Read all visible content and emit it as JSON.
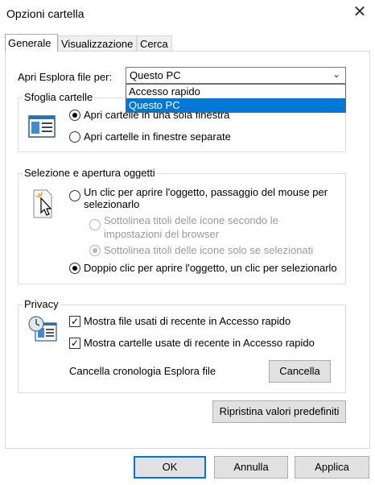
{
  "window": {
    "title": "Opzioni cartella",
    "close_glyph": "✕"
  },
  "tabs": [
    {
      "label": "Generale",
      "active": true
    },
    {
      "label": "Visualizzazione",
      "active": false
    },
    {
      "label": "Cerca",
      "active": false
    }
  ],
  "open_explorer": {
    "label": "Apri Esplora file per:",
    "selected": "Questo PC",
    "options": [
      "Accesso rapido",
      "Questo PC"
    ],
    "highlighted_option": "Questo PC"
  },
  "browse_folders": {
    "legend": "Sfoglia cartelle",
    "option_same_window": "Apri cartelle in una sola finestra",
    "option_separate_windows": "Apri cartelle in finestre separate",
    "selected": "same_window"
  },
  "click_items": {
    "legend": "Selezione e apertura oggetti",
    "single_click_line1": "Un clic per aprire l'oggetto, passaggio del mouse per",
    "single_click_line2": "selezionarlo",
    "underline_always_line1": "Sottolinea titoli delle icone secondo le",
    "underline_always_line2": "impostazioni del browser",
    "underline_hover": "Sottolinea titoli delle icone solo se selezionati",
    "double_click": "Doppio clic per aprire l'oggetto, un clic per selezionarlo",
    "selected": "double_click"
  },
  "privacy": {
    "legend": "Privacy",
    "recent_files": "Mostra file usati di recente in Accesso rapido",
    "recent_folders": "Mostra cartelle usate di recente in Accesso rapido",
    "clear_label": "Cancella cronologia Esplora file",
    "clear_button": "Cancella",
    "recent_files_checked": true,
    "recent_folders_checked": true
  },
  "restore_defaults": "Ripristina valori predefiniti",
  "footer": {
    "ok": "OK",
    "cancel": "Annulla",
    "apply": "Applica"
  },
  "colors": {
    "accent": "#0078d7",
    "button_bg": "#e1e1e1",
    "disabled_text": "#9b9b9b"
  }
}
